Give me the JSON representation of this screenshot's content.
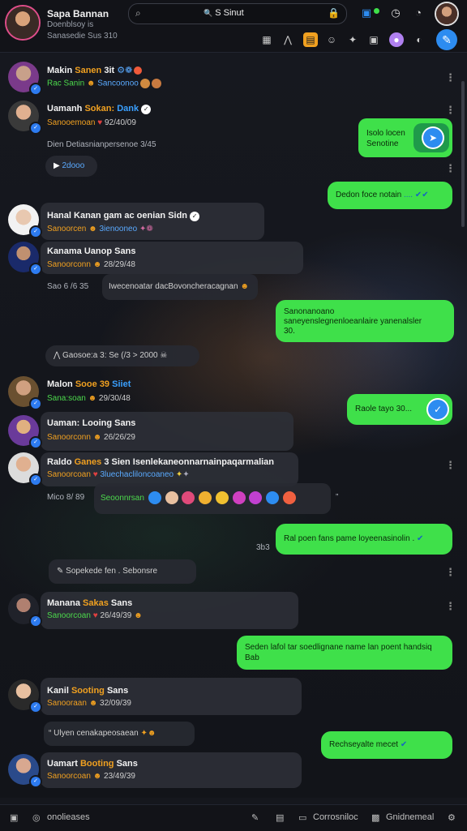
{
  "profile": {
    "name": "Sapa Bannan",
    "sub1": "Doenblsoy is",
    "sub2": "Sanasedie Sus 310"
  },
  "search": {
    "value": "S Sinut"
  },
  "rows": [
    {
      "name": "Makin",
      "hl": "Sanen",
      "tail": "3it",
      "sub_g": "Rac Sanin",
      "sub_b": "Sancoonoo",
      "kebab": true
    },
    {
      "name": "Uamanh",
      "hl": "Sokan:",
      "blue": "Dank",
      "sub_o": "Sanooemoan",
      "sub_w": "92/40/09",
      "kebab": true
    },
    {
      "name": "Hanal",
      "mid": "Kanan gam",
      "tail": "ac oenian Sidn",
      "sub_o": "Sanoorcen",
      "sub_b": "3ienooneo"
    },
    {
      "name": "Kanama",
      "mid": "Uanop",
      "tail": "Sans",
      "sub_o": "Sanoorconn",
      "sub_w": "28/29/48"
    },
    {
      "name": "Malon",
      "hl": "Sooe",
      "tail": "39",
      "blue": "Siiet",
      "sub_g": "Sana:soan",
      "sub_w": "29/30/48"
    },
    {
      "name": "Uaman:",
      "mid": "Looing",
      "tail": "Sans",
      "sub_o": "Sanoorconn",
      "sub_w": "26/26/29"
    },
    {
      "name": "Raldo",
      "hl": "Ganes",
      "tail": "3 Sien Isenlekaneonnarnainpaqarmalian",
      "sub_o": "Sanoorcoan",
      "sub_b": "3luechacliloncoaneo"
    },
    {
      "name": "Manana",
      "hl": "Sakas",
      "tail": "Sans",
      "sub_g": "Sanoorcoan",
      "sub_w": "26/49/39"
    },
    {
      "name": "Kanil",
      "hl": "Sooting",
      "tail": "Sans",
      "sub_o": "Sanooraan",
      "sub_w": "32/09/39"
    },
    {
      "name": "Uamart",
      "hl": "Booting",
      "tail": "Sans",
      "sub_o": "Sanoorcoan",
      "sub_w": "23/49/39"
    }
  ],
  "meta": {
    "m1": "Dien Detiasnianpersenoe 3/45",
    "m1_pill": "2dooo",
    "m2_left": "Sao 6 /6 35",
    "m2_text": "Iwecenoatar dacBovoncheracagnan",
    "m3_pill": "Gaosoe:a 3: Se (/3 > 2000",
    "m4_left": "Mico 8/ 89",
    "m4_pill": "Seoonnrsan",
    "m5_left": "3b3",
    "m6_pill": "Sopekede fen . Sebonsre",
    "m7_text": "Ulyen cenakapeosaean"
  },
  "bubbles": {
    "b1_line1": "Isolo locen",
    "b1_line2": "Senotine",
    "b2": "Dedon foce notain",
    "b3_line1": "Sanonanoano",
    "b3_line2": "saneyenslegnenloeanlaire yanenalsler",
    "b3_line3": "30.",
    "b4": "Raole tayo 30...",
    "b5": "Ral poen fans pame loyeenasinolin .",
    "b6_line1": "Seden lafol tar soedlignane name lan poent handsiq",
    "b6_line2": "Bab",
    "b7": "Rechseyalte mecet"
  },
  "bottom": {
    "b1": "onolieases",
    "b2": "Corrosniloc",
    "b3": "Gnidnemeal"
  },
  "colors": {
    "accent_green": "#3fe04a",
    "accent_blue": "#2d8cf0",
    "highlight_orange": "#f0a020"
  }
}
